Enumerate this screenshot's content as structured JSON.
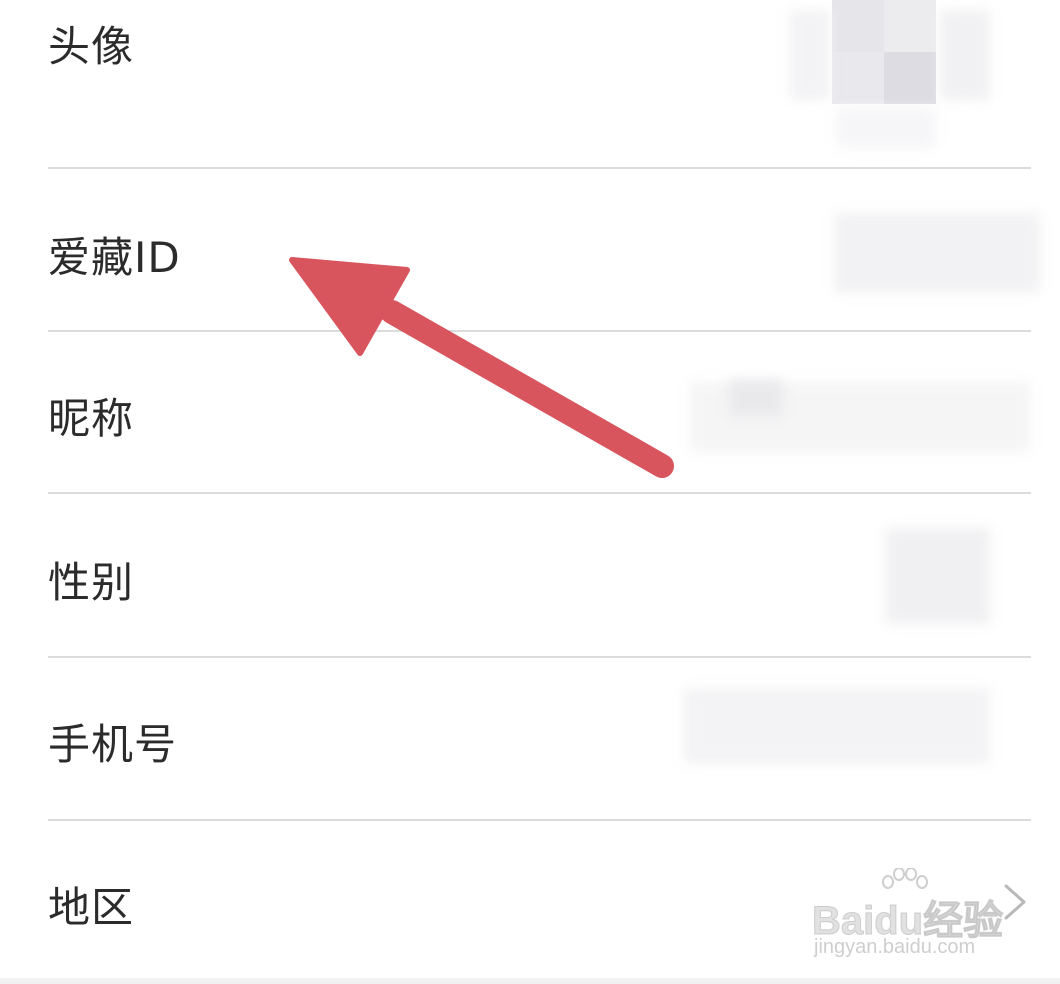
{
  "settings": {
    "rows": [
      {
        "label": "头像"
      },
      {
        "label": "爱藏ID"
      },
      {
        "label": "昵称"
      },
      {
        "label": "性别"
      },
      {
        "label": "手机号"
      },
      {
        "label": "地区"
      }
    ]
  },
  "watermark": {
    "brand": "Baidu经验",
    "url": "jingyan.baidu.com"
  },
  "annotation": {
    "arrow_color": "#d9555e",
    "target": "爱藏ID"
  },
  "colors": {
    "text": "#2b2b2b",
    "divider": "#dcdcdc",
    "background": "#ffffff"
  },
  "icons": {
    "row_chevron": "chevron-right-icon"
  }
}
